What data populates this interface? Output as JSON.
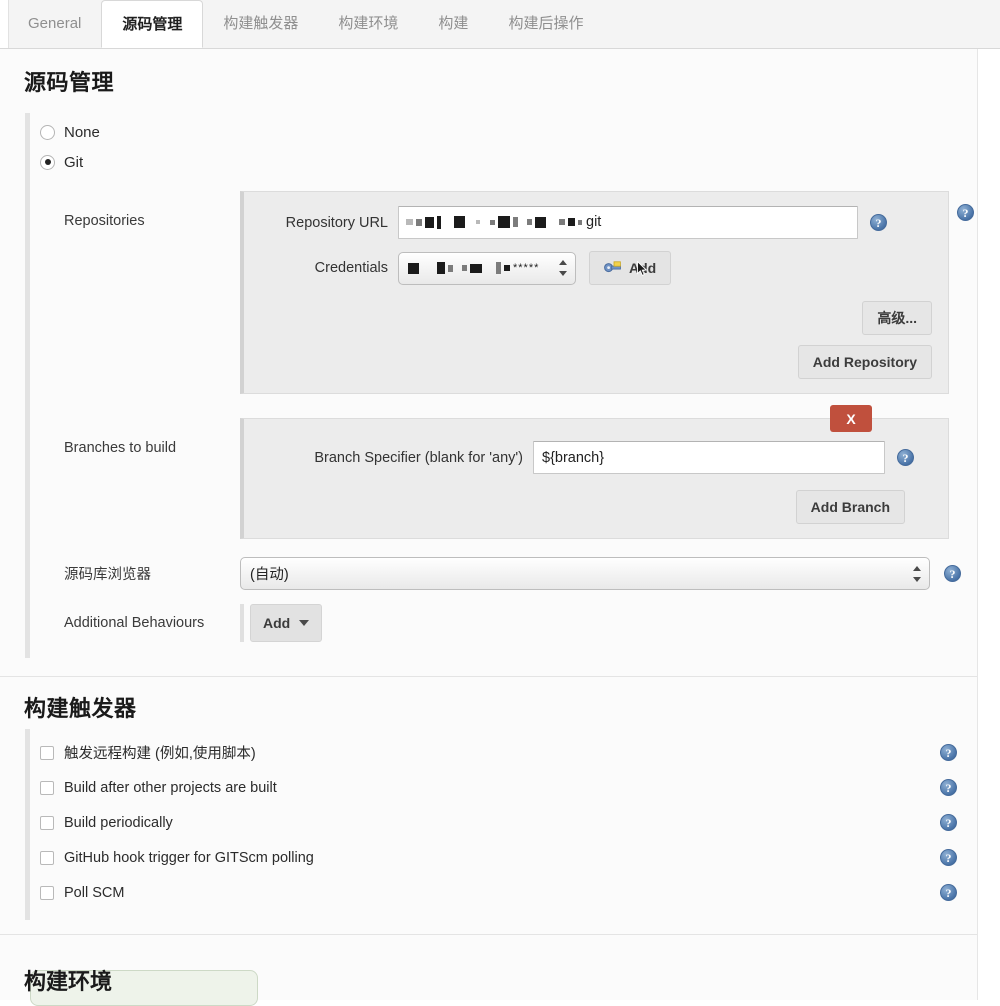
{
  "tabs": [
    {
      "label": "General",
      "active": false
    },
    {
      "label": "源码管理",
      "active": true
    },
    {
      "label": "构建触发器",
      "active": false
    },
    {
      "label": "构建环境",
      "active": false
    },
    {
      "label": "构建",
      "active": false
    },
    {
      "label": "构建后操作",
      "active": false
    }
  ],
  "scm": {
    "title": "源码管理",
    "options": [
      {
        "label": "None",
        "selected": false
      },
      {
        "label": "Git",
        "selected": true
      }
    ],
    "repositories": {
      "label": "Repositories",
      "repository_url": {
        "label": "Repository URL",
        "value_visible_suffix": "git",
        "redacted": true
      },
      "credentials": {
        "label": "Credentials",
        "value_visible_suffix": "*****",
        "redacted": true
      },
      "add_credentials_button": "Add",
      "advanced_button": "高级...",
      "add_repository_button": "Add Repository"
    },
    "branches": {
      "label": "Branches to build",
      "delete_button": "X",
      "branch_specifier": {
        "label": "Branch Specifier (blank for 'any')",
        "value": "${branch}"
      },
      "add_branch_button": "Add Branch"
    },
    "repository_browser": {
      "label": "源码库浏览器",
      "value": "(自动)"
    },
    "additional_behaviours": {
      "label": "Additional Behaviours",
      "add_button": "Add"
    }
  },
  "triggers": {
    "title": "构建触发器",
    "items": [
      {
        "label": "触发远程构建 (例如,使用脚本)",
        "checked": false
      },
      {
        "label": "Build after other projects are built",
        "checked": false
      },
      {
        "label": "Build periodically",
        "checked": false
      },
      {
        "label": "GitHub hook trigger for GITScm polling",
        "checked": false
      },
      {
        "label": "Poll SCM",
        "checked": false
      }
    ]
  },
  "build_env": {
    "title": "构建环境"
  },
  "icons": {
    "help": "?"
  },
  "colors": {
    "delete_red": "#c0503d",
    "help_blue": "#4a74a8",
    "panel_gray": "#ececec",
    "page_bg": "#fbfbfb",
    "tooltip_green": "#eef3ea"
  }
}
